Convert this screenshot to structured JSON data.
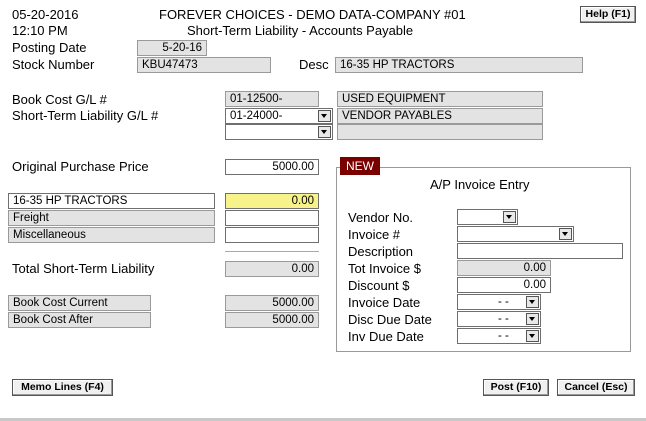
{
  "header": {
    "date": "05-20-2016",
    "time": "12:10 PM",
    "company": "FOREVER CHOICES - DEMO DATA-COMPANY #01",
    "subtitle": "Short-Term Liability - Accounts Payable",
    "help_button": "Help (F1)"
  },
  "posting": {
    "label": "Posting Date",
    "value": "5-20-16"
  },
  "stock": {
    "label": "Stock Number",
    "value": "KBU47473",
    "desc_label": "Desc",
    "desc_value": "16-35 HP TRACTORS"
  },
  "gl": {
    "book_cost_label": "Book Cost G/L #",
    "book_cost_account": "01-12500-",
    "book_cost_name": "USED EQUIPMENT",
    "stl_label": "Short-Term Liability G/L #",
    "stl_account": "01-24000-",
    "stl_name": "VENDOR PAYABLES",
    "third_account": "",
    "third_name": ""
  },
  "purchase": {
    "label": "Original Purchase Price",
    "value": "5000.00"
  },
  "lines": [
    {
      "label": "16-35 HP TRACTORS",
      "value": "0.00"
    },
    {
      "label": "Freight",
      "value": ""
    },
    {
      "label": "Miscellaneous",
      "value": ""
    }
  ],
  "total": {
    "label": "Total Short-Term Liability",
    "value": "0.00"
  },
  "book_cost": {
    "current_label": "Book Cost Current",
    "current_value": "5000.00",
    "after_label": "Book Cost After",
    "after_value": "5000.00"
  },
  "invoice": {
    "badge": "NEW",
    "title": "A/P Invoice Entry",
    "vendor_label": "Vendor No.",
    "vendor_value": "",
    "invoice_label": "Invoice #",
    "invoice_value": "",
    "description_label": "Description",
    "description_value": "",
    "tot_label": "Tot Invoice $",
    "tot_value": "0.00",
    "discount_label": "Discount $",
    "discount_value": "0.00",
    "invoice_date_label": "Invoice Date",
    "invoice_date_value": "- -",
    "disc_due_label": "Disc Due Date",
    "disc_due_value": "- -",
    "inv_due_label": "Inv Due Date",
    "inv_due_value": "- -"
  },
  "footer": {
    "memo_button": "Memo Lines (F4)",
    "post_button": "Post (F10)",
    "cancel_button": "Cancel (Esc)"
  },
  "colors": {
    "badge_bg": "#7a0000",
    "yellow_field": "#f7f28a",
    "readonly_bg": "#e3e3e3"
  }
}
